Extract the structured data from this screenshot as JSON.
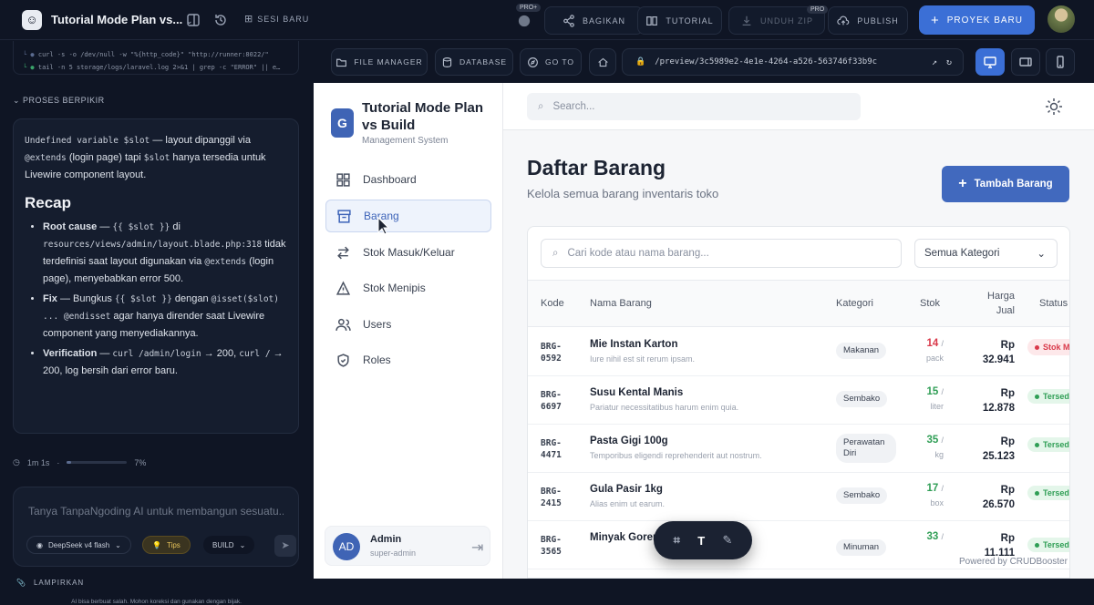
{
  "topbar": {
    "project_title": "Tutorial Mode Plan vs...",
    "sesi_label": "SESI BARU",
    "pro_badge": "PRO+",
    "pro_badge2": "PRO",
    "bagikan": "BAGIKAN",
    "tutorial": "TUTORIAL",
    "unduh": "UNDUH ZIP",
    "publish": "PUBLISH",
    "proyek": "PROYEK BARU"
  },
  "chat": {
    "code_line1": "curl -s -o /dev/null -w \"%{http_code}\" \"http://runner:8022/\"",
    "code_line2": "tail -n 5 storage/logs/laravel.log 2>&1 | grep -c \"ERROR\" || e…",
    "think_label": "PROSES BERPIKIR",
    "intro_code1": "Undefined variable $slot",
    "intro_text1": " — layout dipanggil via ",
    "intro_code2": "@extends",
    "intro_text2": " (login page) tapi ",
    "intro_code3": "$slot",
    "intro_text3": " hanya tersedia untuk Livewire component layout.",
    "recap_title": "Recap",
    "b1_title": "Root cause",
    "b1_dash": " — ",
    "b1_code1": "{{ $slot }}",
    "b1_text1": " di ",
    "b1_code2": "resources/views/admin/layout.blade.php:318",
    "b1_text2": " tidak terdefinisi saat layout digunakan via ",
    "b1_code3": "@extends",
    "b1_text3": " (login page), menyebabkan error 500.",
    "b2_title": "Fix",
    "b2_text1": " — Bungkus ",
    "b2_code1": "{{ $slot }}",
    "b2_text2": " dengan ",
    "b2_code2": "@isset($slot) ... @endisset",
    "b2_text3": " agar hanya dirender saat Livewire component yang menyediakannya.",
    "b3_title": "Verification",
    "b3_text1": " — ",
    "b3_code1": "curl /admin/login",
    "b3_text2": " → 200, ",
    "b3_code2": "curl /",
    "b3_text3": " → 200, log bersih dari error baru.",
    "elapsed": "1m 1s",
    "progress_label": "7%",
    "progress_value": 0.07,
    "input_placeholder": "Tanya TanpaNgoding AI untuk membangun sesuatu...",
    "model": "DeepSeek v4 flash",
    "tips": "Tips",
    "mode": "BUILD",
    "attach": "LAMPIRKAN",
    "disclaimer": "AI bisa berbuat salah. Mohon koreksi dan gunakan dengan bijak."
  },
  "preview_toolbar": {
    "file_manager": "FILE MANAGER",
    "database": "DATABASE",
    "goto": "GO TO",
    "url": "/preview/3c5989e2-4e1e-4264-a526-563746f33b9c"
  },
  "app": {
    "name": "Tutorial Mode Plan vs Build",
    "subtitle": "Management System",
    "nav": [
      "Dashboard",
      "Barang",
      "Stok Masuk/Keluar",
      "Stok Menipis",
      "Users",
      "Roles"
    ],
    "user_initials": "AD",
    "user_name": "Admin",
    "user_role": "super-admin",
    "search_placeholder": "Search...",
    "page_title": "Daftar Barang",
    "page_subtitle": "Kelola semua barang inventaris toko",
    "add_button": "Tambah Barang",
    "table_search_placeholder": "Cari kode atau nama barang...",
    "category_filter": "Semua Kategori",
    "columns": {
      "kode": "Kode",
      "nama": "Nama Barang",
      "kategori": "Kategori",
      "stok": "Stok",
      "harga1": "Harga",
      "harga2": "Jual",
      "status": "Status"
    },
    "rows": [
      {
        "kode1": "BRG-",
        "kode2": "0592",
        "nama": "Mie Instan Karton",
        "desc": "Iure nihil est sit rerum ipsam.",
        "kategori": "Makanan",
        "stok": "14",
        "unit": "pack",
        "harga1": "Rp",
        "harga2": "32.941",
        "status": "Stok Menipis"
      },
      {
        "kode1": "BRG-",
        "kode2": "6697",
        "nama": "Susu Kental Manis",
        "desc": "Pariatur necessitatibus harum enim quia.",
        "kategori": "Sembako",
        "stok": "15",
        "unit": "liter",
        "harga1": "Rp",
        "harga2": "12.878",
        "status": "Tersedia"
      },
      {
        "kode1": "BRG-",
        "kode2": "4471",
        "nama": "Pasta Gigi 100g",
        "desc": "Temporibus eligendi reprehenderit aut nostrum.",
        "kategori": "Perawatan Diri",
        "stok": "35",
        "unit": "kg",
        "harga1": "Rp",
        "harga2": "25.123",
        "status": "Tersedia"
      },
      {
        "kode1": "BRG-",
        "kode2": "2415",
        "nama": "Gula Pasir 1kg",
        "desc": "Alias enim ut earum.",
        "kategori": "Sembako",
        "stok": "17",
        "unit": "box",
        "harga1": "Rp",
        "harga2": "26.570",
        "status": "Tersedia"
      },
      {
        "kode1": "BRG-",
        "kode2": "3565",
        "nama": "Minyak Goreng",
        "desc": "",
        "kategori": "Minuman",
        "stok": "33",
        "unit": "",
        "harga1": "Rp",
        "harga2": "11.111",
        "status": "Tersedia"
      }
    ],
    "powered": "Powered by CRUDBooster"
  },
  "floating": {
    "text_tool": "T"
  },
  "colors": {
    "accent": "#3b6fd6",
    "low": "#d9394a",
    "ok": "#2f9e55"
  }
}
